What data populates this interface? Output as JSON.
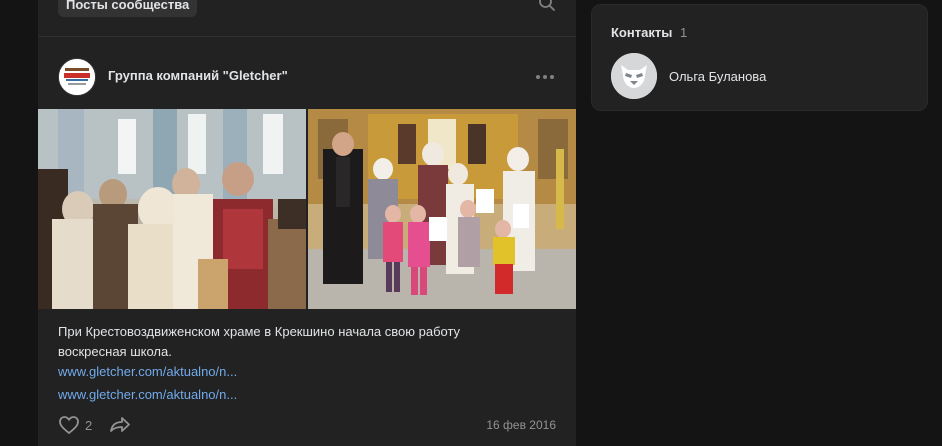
{
  "feed": {
    "tab_label": "Посты сообщества",
    "search_icon": "search-icon"
  },
  "post": {
    "author": "Группа компаний \"Gletcher\"",
    "avatar_text": "GLETCHER",
    "text_line1": "При Крестовоздвиженском храме в Крекшино начала свою работу",
    "text_line2": "воскресная школа.",
    "link1": "www.gletcher.com/aktualno/n...",
    "link2": "www.gletcher.com/aktualno/n...",
    "likes": "2",
    "date": "16 фев 2016",
    "photos": [
      "church-interior-photo",
      "sunday-school-group-photo"
    ]
  },
  "contacts": {
    "title": "Контакты",
    "count": "1",
    "items": [
      {
        "name": "Ольга Буланова",
        "avatar_icon": "default-avatar-icon"
      }
    ]
  },
  "colors": {
    "background": "#141414",
    "card": "#222222",
    "text": "#e1e3e6",
    "secondary": "#939393",
    "link": "#71aaeb"
  }
}
